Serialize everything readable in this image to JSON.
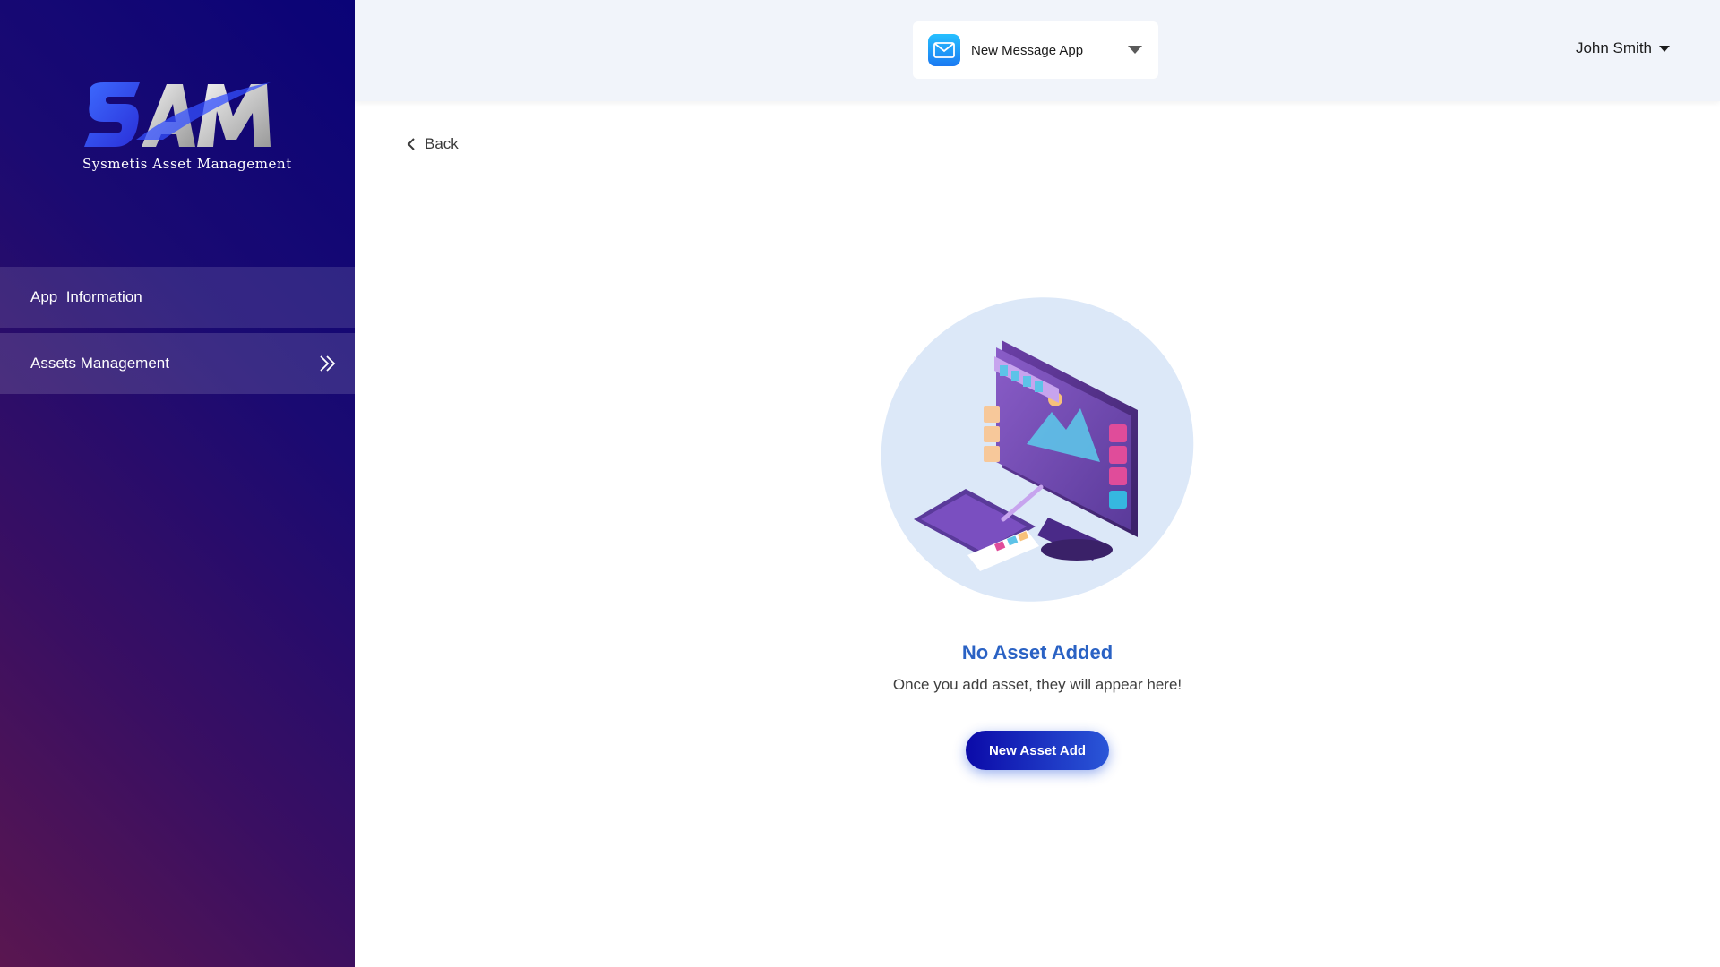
{
  "brand": {
    "logo_text": "SAM",
    "subtitle": "Sysmetis Asset Management"
  },
  "sidebar": {
    "items": [
      {
        "label": "App  Information",
        "icon": null
      },
      {
        "label": "Assets Management",
        "icon": "double-chevron-right-icon"
      }
    ]
  },
  "header": {
    "app_selector": {
      "selected": "New Message App",
      "icon": "mail-icon"
    },
    "user": {
      "name": "John Smith",
      "icon": "caret-down-icon"
    }
  },
  "main": {
    "back_label": "Back",
    "empty_state": {
      "illustration": "computer-design-illustration",
      "title": "No Asset Added",
      "subtitle": "Once you add asset, they will appear here!",
      "button_label": "New Asset Add"
    }
  },
  "colors": {
    "sidebar_gradient_start": "#0a0377",
    "sidebar_gradient_end": "#5a1650",
    "header_bg": "#f1f4fa",
    "accent_title": "#2a62c4",
    "button_start": "#0b0aa8",
    "button_end": "#2a56d8"
  }
}
